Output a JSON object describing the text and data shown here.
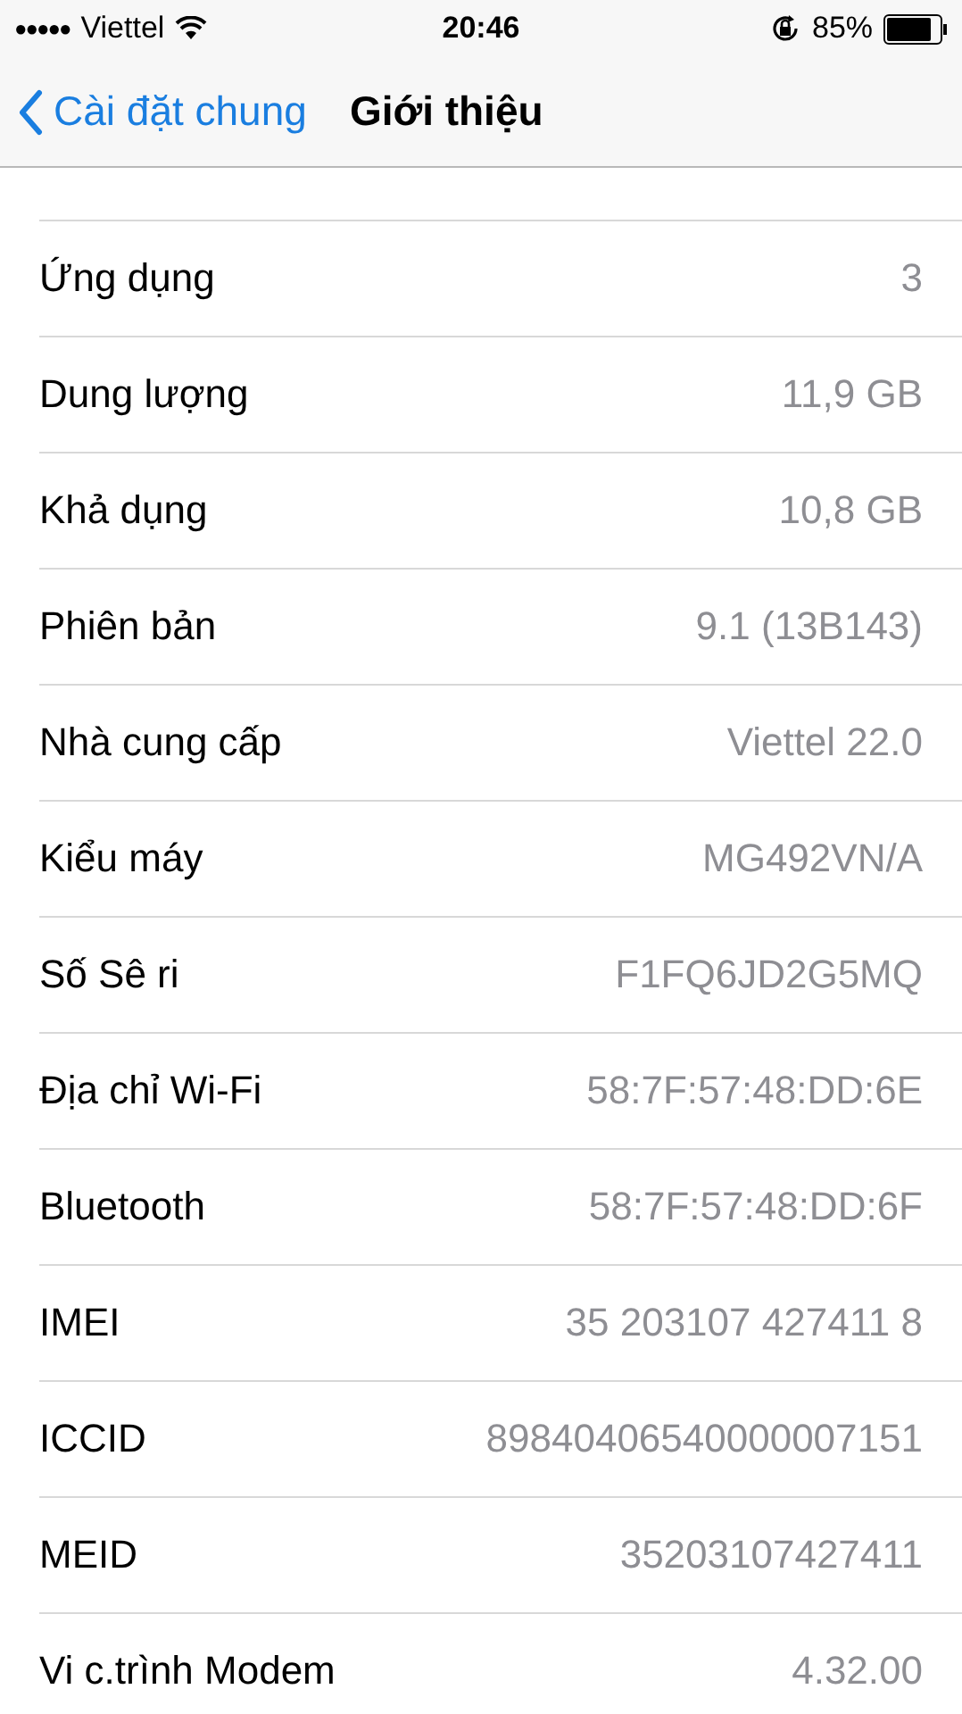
{
  "status_bar": {
    "signal_dots": "●●●●●",
    "carrier": "Viettel",
    "time": "20:46",
    "battery": "85%"
  },
  "nav": {
    "back": "Cài đặt chung",
    "title": "Giới thiệu"
  },
  "rows": [
    {
      "label": "Ứng dụng",
      "value": "3"
    },
    {
      "label": "Dung lượng",
      "value": "11,9 GB"
    },
    {
      "label": "Khả dụng",
      "value": "10,8 GB"
    },
    {
      "label": "Phiên bản",
      "value": "9.1 (13B143)"
    },
    {
      "label": "Nhà cung cấp",
      "value": "Viettel 22.0"
    },
    {
      "label": "Kiểu máy",
      "value": "MG492VN/A"
    },
    {
      "label": "Số Sê ri",
      "value": "F1FQ6JD2G5MQ"
    },
    {
      "label": "Địa chỉ Wi-Fi",
      "value": "58:7F:57:48:DD:6E"
    },
    {
      "label": "Bluetooth",
      "value": "58:7F:57:48:DD:6F"
    },
    {
      "label": "IMEI",
      "value": "35 203107 427411 8"
    },
    {
      "label": "ICCID",
      "value": "89840406540000007151"
    },
    {
      "label": "MEID",
      "value": "35203107427411"
    },
    {
      "label": "Vi c.trình Modem",
      "value": "4.32.00"
    }
  ]
}
